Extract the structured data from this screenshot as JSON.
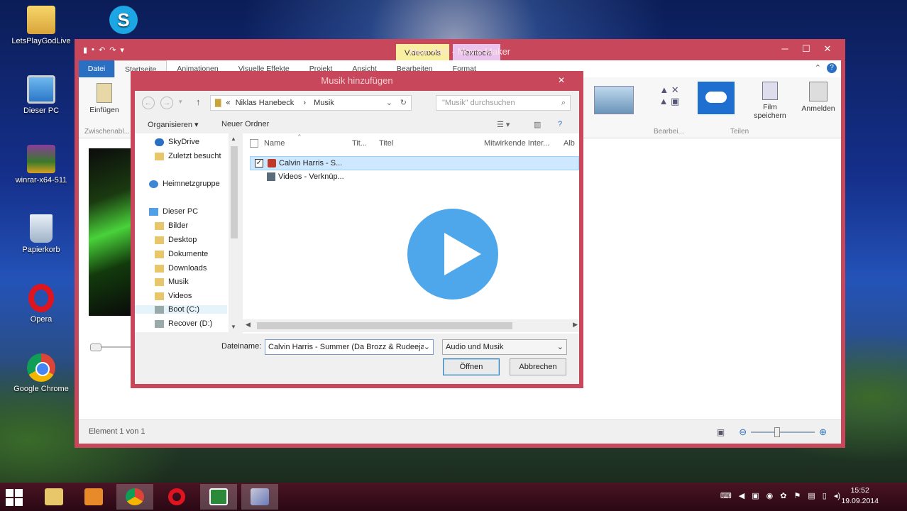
{
  "desktop": {
    "icons": [
      {
        "label": "LetsPlayGodLive",
        "icon": "folder-user-icon"
      },
      {
        "label": "Dieser PC",
        "icon": "computer-icon"
      },
      {
        "label": "winrar-x64-511",
        "icon": "winrar-icon"
      },
      {
        "label": "Papierkorb",
        "icon": "recycle-bin-icon"
      },
      {
        "label": "Opera",
        "icon": "opera-icon"
      },
      {
        "label": "Google Chrome",
        "icon": "chrome-icon"
      },
      {
        "label": "",
        "icon": "skype-icon"
      }
    ]
  },
  "moviemaker": {
    "title": "Mein Film - Movie Maker",
    "context_tabs": {
      "video": "Videotools",
      "text": "Texttools"
    },
    "tabs": {
      "datei": "Datei",
      "startseite": "Startseite",
      "animationen": "Animationen",
      "visuelle": "Visuelle Effekte",
      "projekt": "Projekt",
      "ansicht": "Ansicht",
      "bearbeiten": "Bearbeiten",
      "format": "Format"
    },
    "ribbon": {
      "einfuegen": "Einfügen",
      "zwischenablage": "Zwischenabl...",
      "bearbeiten_group": "Bearbei...",
      "teilen_group": "Teilen",
      "film_speichern": "Film speichern",
      "anmelden": "Anmelden"
    },
    "status": "Element 1 von 1",
    "zoom_level": 0.4
  },
  "dialog": {
    "title": "Musik hinzufügen",
    "breadcrumb": [
      "Niklas Hanebeck",
      "Musik"
    ],
    "breadcrumb_prefix": "«",
    "search_placeholder": "\"Musik\" durchsuchen",
    "toolbar": {
      "organize": "Organisieren ▾",
      "new_folder": "Neuer Ordner"
    },
    "nav": [
      {
        "label": "SkyDrive",
        "icon": "skydrive-icon"
      },
      {
        "label": "Zuletzt besucht",
        "icon": "recent-icon"
      },
      {
        "label": "Heimnetzgruppe",
        "icon": "homegroup-icon"
      },
      {
        "label": "Dieser PC",
        "icon": "computer-icon"
      },
      {
        "label": "Bilder",
        "icon": "folder-icon"
      },
      {
        "label": "Desktop",
        "icon": "folder-icon"
      },
      {
        "label": "Dokumente",
        "icon": "folder-icon"
      },
      {
        "label": "Downloads",
        "icon": "folder-icon"
      },
      {
        "label": "Musik",
        "icon": "folder-icon"
      },
      {
        "label": "Videos",
        "icon": "folder-icon"
      },
      {
        "label": "Boot (C:)",
        "icon": "drive-icon"
      },
      {
        "label": "Recover (D:)",
        "icon": "drive-icon"
      }
    ],
    "columns": [
      "Name",
      "Tit...",
      "Titel",
      "Mitwirkende Inter...",
      "Alb"
    ],
    "files": [
      {
        "name": "Calvin Harris - S...",
        "selected": true
      },
      {
        "name": "Videos - Verknüp...",
        "selected": false
      }
    ],
    "filename_label": "Dateiname:",
    "filename_value": "Calvin Harris - Summer (Da Brozz & Rudeejay",
    "filetype": "Audio und Musik",
    "open": "Öffnen",
    "cancel": "Abbrechen"
  },
  "taskbar": {
    "time": "15:52",
    "date": "19.09.2014"
  }
}
